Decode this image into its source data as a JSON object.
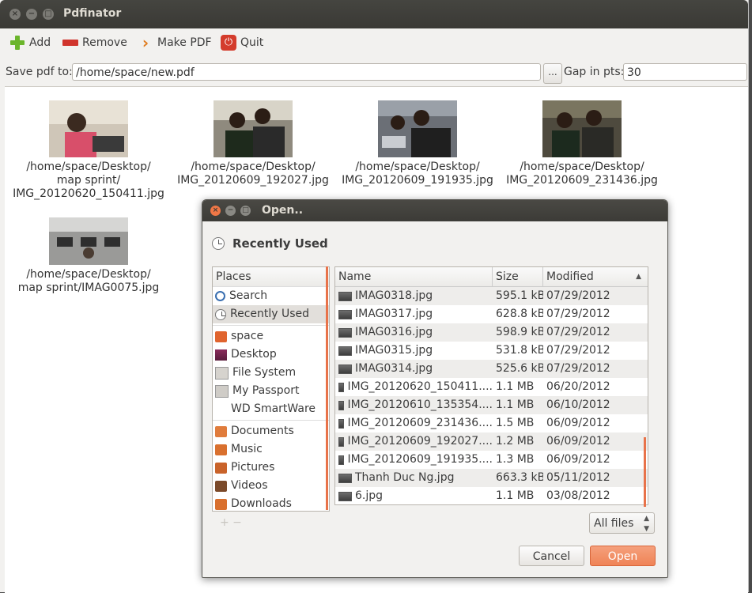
{
  "window": {
    "title": "Pdfinator"
  },
  "toolbar": {
    "add": "Add",
    "remove": "Remove",
    "make_pdf": "Make PDF",
    "quit": "Quit"
  },
  "save_row": {
    "label": "Save pdf to:",
    "path": "/home/space/new.pdf",
    "browse": "...",
    "gap_label": "Gap in pts:",
    "gap_value": "30"
  },
  "thumbnails": [
    {
      "l1": "/home/space/Desktop/",
      "l2": "map sprint/",
      "l3": "IMG_20120620_150411.jpg"
    },
    {
      "l1": "/home/space/Desktop/",
      "l2": "IMG_20120609_192027.jpg",
      "l3": ""
    },
    {
      "l1": "/home/space/Desktop/",
      "l2": "IMG_20120609_191935.jpg",
      "l3": ""
    },
    {
      "l1": "/home/space/Desktop/",
      "l2": "IMG_20120609_231436.jpg",
      "l3": ""
    },
    {
      "l1": "/home/space/Desktop/",
      "l2": "map sprint/IMAG0075.jpg",
      "l3": ""
    }
  ],
  "dialog": {
    "title": "Open..",
    "location": "Recently Used",
    "places_header": "Places",
    "places": [
      "Search",
      "Recently Used",
      "space",
      "Desktop",
      "File System",
      "My Passport",
      "WD SmartWare",
      "Documents",
      "Music",
      "Pictures",
      "Videos",
      "Downloads"
    ],
    "add_remove": "+   −",
    "columns": {
      "name": "Name",
      "size": "Size",
      "modified": "Modified"
    },
    "files": [
      {
        "name": "IMAG0318.jpg",
        "size": "595.1 kB",
        "modified": "07/29/2012"
      },
      {
        "name": "IMAG0317.jpg",
        "size": "628.8 kB",
        "modified": "07/29/2012"
      },
      {
        "name": "IMAG0316.jpg",
        "size": "598.9 kB",
        "modified": "07/29/2012"
      },
      {
        "name": "IMAG0315.jpg",
        "size": "531.8 kB",
        "modified": "07/29/2012"
      },
      {
        "name": "IMAG0314.jpg",
        "size": "525.6 kB",
        "modified": "07/29/2012"
      },
      {
        "name": "IMG_20120620_150411....",
        "size": "1.1 MB",
        "modified": "06/20/2012"
      },
      {
        "name": "IMG_20120610_135354....",
        "size": "1.1 MB",
        "modified": "06/10/2012"
      },
      {
        "name": "IMG_20120609_231436....",
        "size": "1.5 MB",
        "modified": "06/09/2012"
      },
      {
        "name": "IMG_20120609_192027....",
        "size": "1.2 MB",
        "modified": "06/09/2012"
      },
      {
        "name": "IMG_20120609_191935....",
        "size": "1.3 MB",
        "modified": "06/09/2012"
      },
      {
        "name": "Thanh Duc Ng.jpg",
        "size": "663.3 kB",
        "modified": "05/11/2012"
      },
      {
        "name": "6.jpg",
        "size": "1.1 MB",
        "modified": "03/08/2012"
      }
    ],
    "filter": "All files",
    "cancel": "Cancel",
    "open": "Open"
  }
}
